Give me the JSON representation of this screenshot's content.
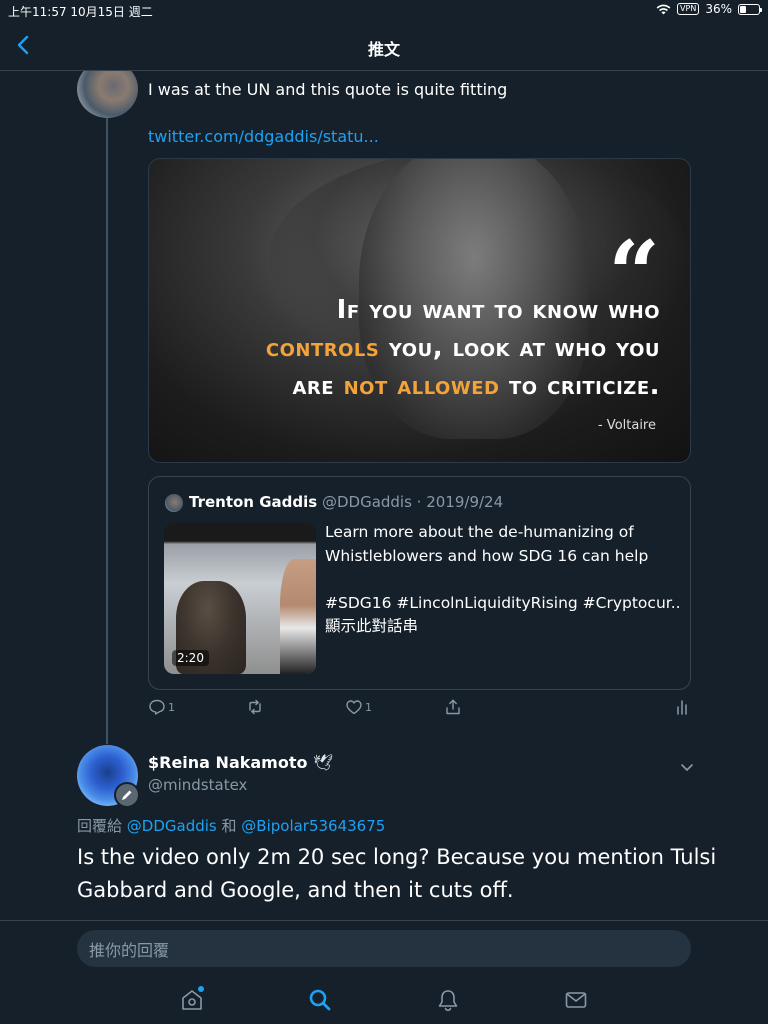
{
  "status_bar": {
    "time_date": "上午11:57   10月15日 週二",
    "vpn": "VPN",
    "battery": "36%",
    "battery_level": 0.36
  },
  "nav": {
    "title": "推文"
  },
  "tweet1": {
    "text": "I was at the UN and this quote is quite fitting",
    "link": "twitter.com/ddgaddis/statu..."
  },
  "quote_image": {
    "quote_mark": "“",
    "line1": "If you want to know who",
    "line2_hl": "controls",
    "line2_rest": " you, look at who you",
    "line3_a": "are ",
    "line3_hl": "not allowed",
    "line3_b": " to criticize.",
    "author": "- Voltaire",
    "highlight_color": "#f2a33a"
  },
  "quoted_tweet": {
    "name": "Trenton Gaddis",
    "meta": " @DDGaddis · 2019/9/24",
    "duration": "2:20",
    "text_line1": "Learn more about the de-humanizing of",
    "text_line2": "Whistleblowers and how SDG 16 can help",
    "text_line3": "#SDG16 #LincolnLiquidityRising #Cryptocur...",
    "show_thread": "顯示此對話串"
  },
  "actions": {
    "reply_count": "1",
    "like_count": "1"
  },
  "reply": {
    "name": "$Reina Nakamoto",
    "name_emoji": "🕊",
    "handle": "@mindstatex",
    "reply_prefix": "回覆給 ",
    "mention1": "@DDGaddis",
    "joiner": " 和 ",
    "mention2": "@Bipolar53643675",
    "body": "Is the video only 2m 20 sec long? Because you mention Tulsi Gabbard and Google, and then it cuts off."
  },
  "composer": {
    "placeholder": "推你的回覆"
  },
  "colors": {
    "background": "#15202b",
    "accent": "#1da1f2",
    "secondary_text": "#8899a6",
    "border": "#38444d"
  }
}
